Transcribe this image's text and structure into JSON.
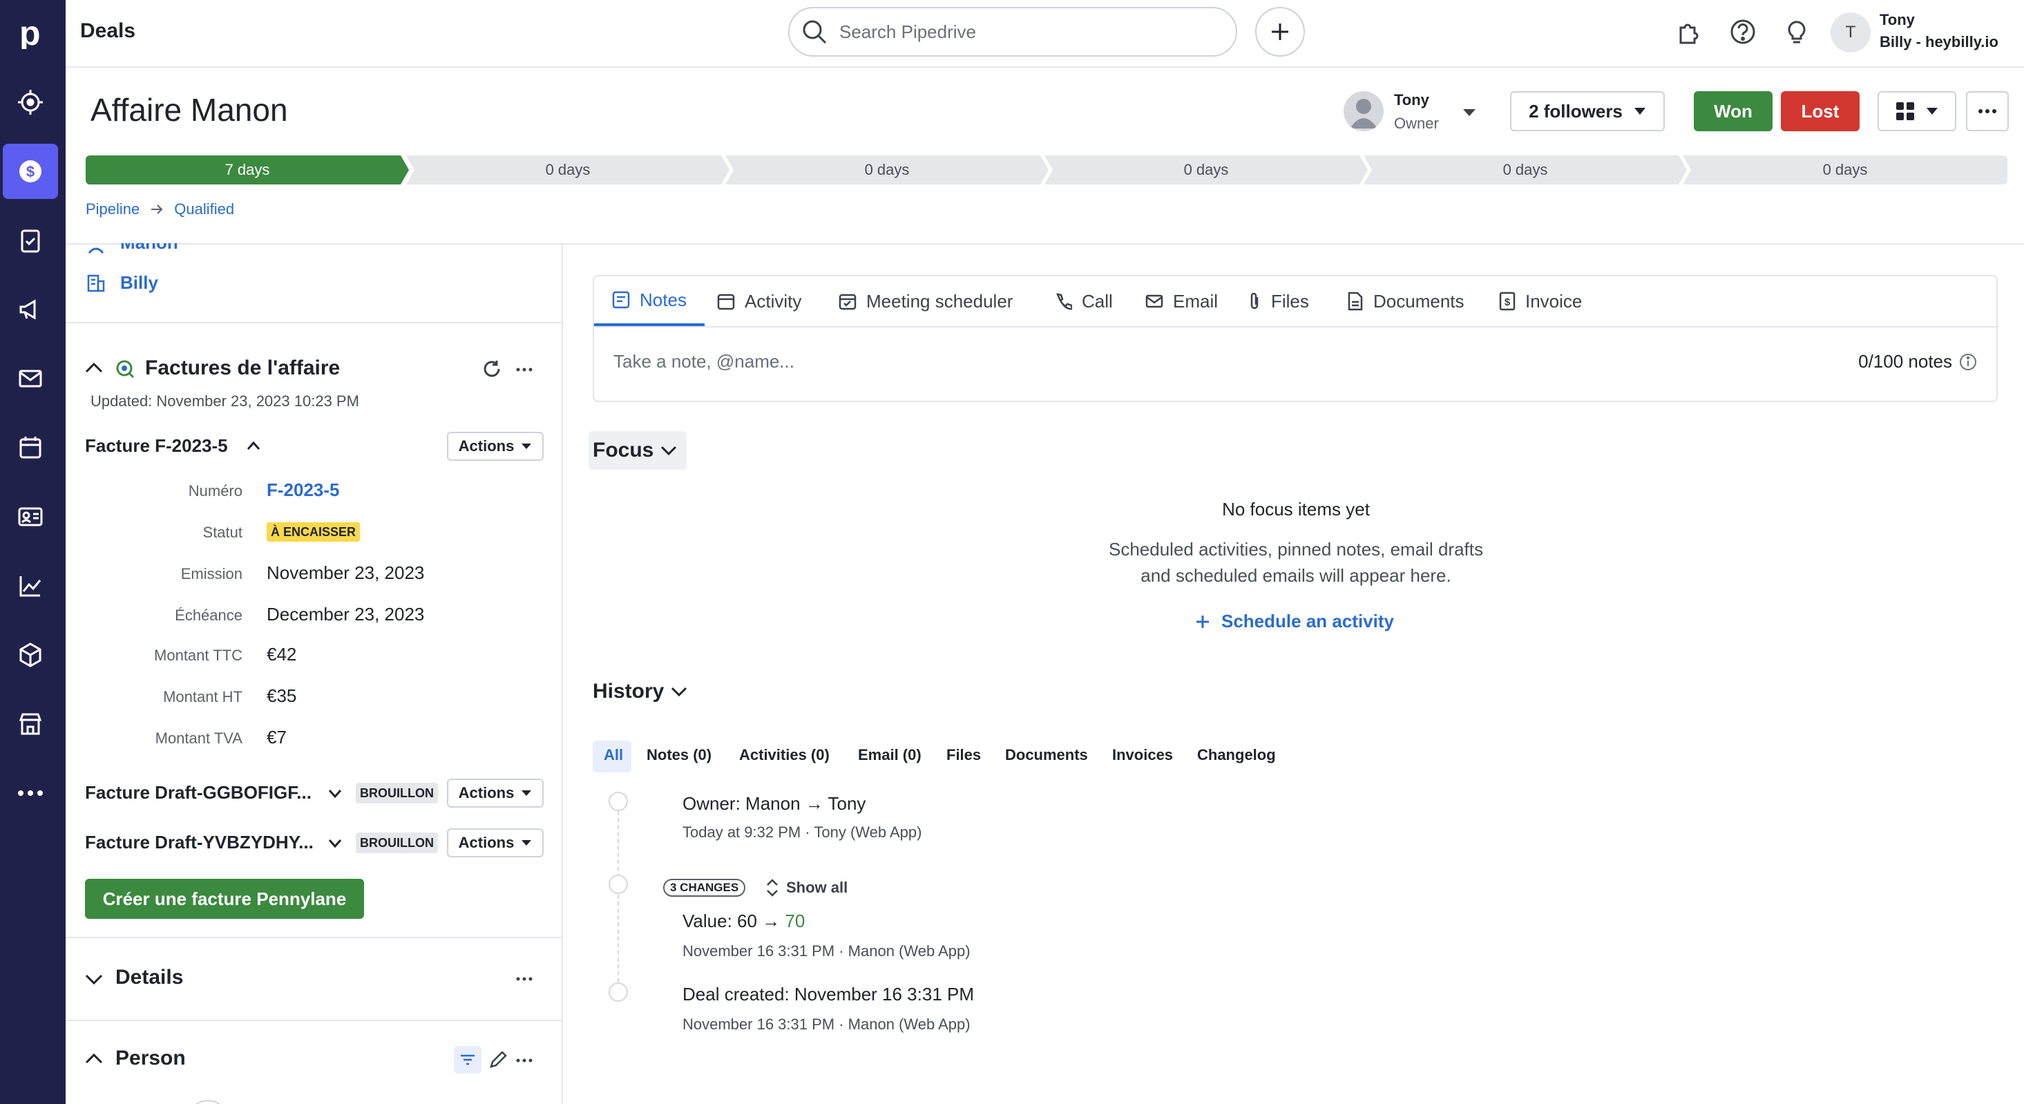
{
  "topbar": {
    "page_title": "Deals",
    "search_placeholder": "Search Pipedrive",
    "user_name": "Tony",
    "user_company": "Billy - heybilly.io",
    "avatar_initial": "T"
  },
  "deal": {
    "title": "Affaire Manon",
    "owner_name": "Tony",
    "owner_role": "Owner",
    "followers_label": "2 followers",
    "won_label": "Won",
    "lost_label": "Lost",
    "stages": [
      {
        "label": "7 days",
        "active": true
      },
      {
        "label": "0 days",
        "active": false
      },
      {
        "label": "0 days",
        "active": false
      },
      {
        "label": "0 days",
        "active": false
      },
      {
        "label": "0 days",
        "active": false
      },
      {
        "label": "0 days",
        "active": false
      }
    ],
    "breadcrumb": {
      "pipeline": "Pipeline",
      "stage": "Qualified"
    }
  },
  "sidebar_contacts": {
    "person": "Manon",
    "org": "Billy"
  },
  "invoices": {
    "section_title": "Factures de l'affaire",
    "updated": "Updated: November 23, 2023 10:23 PM",
    "actions_label": "Actions",
    "current": {
      "title": "Facture F-2023-5",
      "fields": [
        {
          "label": "Numéro",
          "value": "F-2023-5"
        },
        {
          "label": "Statut",
          "value": "À ENCAISSER"
        },
        {
          "label": "Emission",
          "value": "November 23, 2023"
        },
        {
          "label": "Échéance",
          "value": "December 23, 2023"
        },
        {
          "label": "Montant TTC",
          "value": "€42"
        },
        {
          "label": "Montant HT",
          "value": "€35"
        },
        {
          "label": "Montant TVA",
          "value": "€7"
        }
      ]
    },
    "drafts": [
      {
        "title": "Facture Draft-GGBOFIGF...",
        "status": "BROUILLON"
      },
      {
        "title": "Facture Draft-YVBZYDHY...",
        "status": "BROUILLON"
      }
    ],
    "create_label": "Créer une facture Pennylane"
  },
  "sections": {
    "details": "Details",
    "person": "Person"
  },
  "tabs": [
    {
      "label": "Notes",
      "icon": "note-icon"
    },
    {
      "label": "Activity",
      "icon": "calendar-icon"
    },
    {
      "label": "Meeting scheduler",
      "icon": "meeting-icon"
    },
    {
      "label": "Call",
      "icon": "phone-icon"
    },
    {
      "label": "Email",
      "icon": "mail-icon"
    },
    {
      "label": "Files",
      "icon": "paperclip-icon"
    },
    {
      "label": "Documents",
      "icon": "document-icon"
    },
    {
      "label": "Invoice",
      "icon": "invoice-icon"
    }
  ],
  "note": {
    "placeholder": "Take a note, @name...",
    "counter": "0/100 notes"
  },
  "focus": {
    "title": "Focus",
    "empty_title": "No focus items yet",
    "empty_line1": "Scheduled activities, pinned notes, email drafts",
    "empty_line2": "and scheduled emails will appear here.",
    "schedule_label": "Schedule an activity"
  },
  "history": {
    "title": "History",
    "filters": [
      "All",
      "Notes (0)",
      "Activities (0)",
      "Email (0)",
      "Files",
      "Documents",
      "Invoices",
      "Changelog"
    ],
    "events": [
      {
        "label": "Owner",
        "text": "Manon → Tony",
        "meta": "Today at 9:32 PM · Tony (Web App)"
      },
      {
        "label": "Value",
        "from": "60 →",
        "to": "70",
        "meta": "November 16 3:31 PM · Manon (Web App)",
        "changes": "3 CHANGES",
        "show_all": "Show all"
      },
      {
        "label": "Deal created",
        "text": "November 16 3:31 PM",
        "meta": "November 16 3:31 PM · Manon (Web App)"
      }
    ]
  },
  "colors": {
    "rail": "#20214b",
    "accent": "#2a6bd1",
    "won": "#3b8a3f",
    "lost": "#d2372f",
    "stage_active": "#3b8a3f"
  }
}
